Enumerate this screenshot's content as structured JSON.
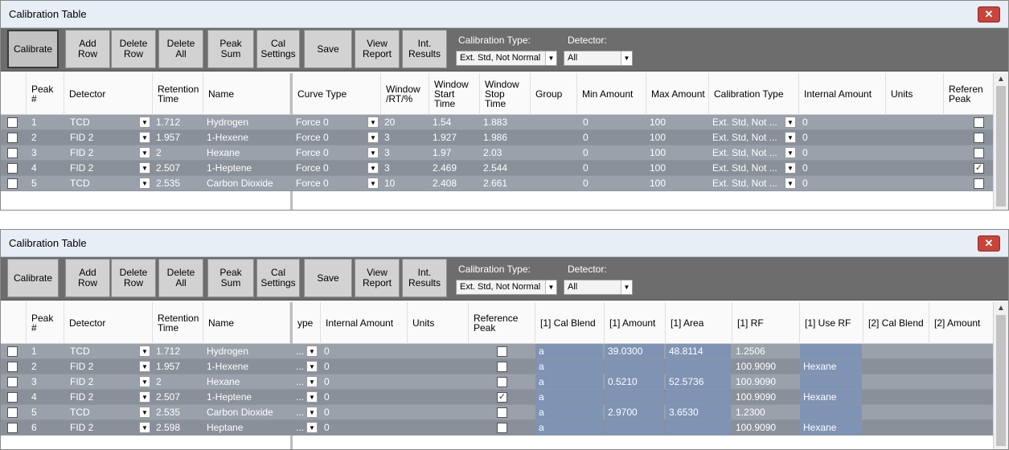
{
  "window": {
    "title": "Calibration Table",
    "close_glyph": "✕"
  },
  "toolbar": {
    "buttons": {
      "calibrate": "Calibrate",
      "add_row": "Add\nRow",
      "delete_row": "Delete\nRow",
      "delete_all": "Delete\nAll",
      "peak_sum": "Peak\nSum",
      "cal_settings": "Cal\nSettings",
      "save": "Save",
      "view_report": "View\nReport",
      "int_results": "Int.\nResults"
    },
    "calibration_type_label": "Calibration Type:",
    "calibration_type_value": "Ext. Std, Not Normal",
    "detector_label": "Detector:",
    "detector_value": "All"
  },
  "colors": {
    "row_light": "#9aa1ab",
    "row_dark": "#8a9099",
    "highlight": "#7f93b4",
    "toolbar": "#6d6d6d"
  },
  "panel1": {
    "headers": {
      "peak": "Peak\n#",
      "detector": "Detector",
      "retention_time": "Retention\nTime",
      "name": "Name",
      "curve_type": "Curve Type",
      "window": "Window\n/RT/%",
      "window_start": "Window\nStart\nTime",
      "window_stop": "Window\nStop\nTime",
      "group": "Group",
      "min_amount": "Min Amount",
      "max_amount": "Max Amount",
      "calibration_type": "Calibration Type",
      "internal_amount": "Internal Amount",
      "units": "Units",
      "reference_peak": "Referen\nPeak"
    },
    "rows": [
      {
        "peak": "1",
        "detector": "TCD",
        "rt": "1.712",
        "name": "Hydrogen",
        "curve": "Force 0",
        "window": "20",
        "start": "1.54",
        "stop": "1.883",
        "group": "",
        "min": "0",
        "max": "100",
        "caltype": "Ext. Std, Not ...",
        "internal": "0",
        "units": "",
        "ref": ""
      },
      {
        "peak": "2",
        "detector": "FID 2",
        "rt": "1.957",
        "name": "1-Hexene",
        "curve": "Force 0",
        "window": "3",
        "start": "1.927",
        "stop": "1.986",
        "group": "",
        "min": "0",
        "max": "100",
        "caltype": "Ext. Std, Not ...",
        "internal": "0",
        "units": "",
        "ref": ""
      },
      {
        "peak": "3",
        "detector": "FID 2",
        "rt": "2",
        "name": "Hexane",
        "curve": "Force 0",
        "window": "3",
        "start": "1.97",
        "stop": "2.03",
        "group": "",
        "min": "0",
        "max": "100",
        "caltype": "Ext. Std, Not ...",
        "internal": "0",
        "units": "",
        "ref": ""
      },
      {
        "peak": "4",
        "detector": "FID 2",
        "rt": "2.507",
        "name": "1-Heptene",
        "curve": "Force 0",
        "window": "3",
        "start": "2.469",
        "stop": "2.544",
        "group": "",
        "min": "0",
        "max": "100",
        "caltype": "Ext. Std, Not ...",
        "internal": "0",
        "units": "",
        "ref": "✓"
      },
      {
        "peak": "5",
        "detector": "TCD",
        "rt": "2.535",
        "name": "Carbon Dioxide",
        "curve": "Force 0",
        "window": "10",
        "start": "2.408",
        "stop": "2.661",
        "group": "",
        "min": "0",
        "max": "100",
        "caltype": "Ext. Std, Not ...",
        "internal": "0",
        "units": "",
        "ref": ""
      }
    ]
  },
  "panel2": {
    "headers": {
      "peak": "Peak\n#",
      "detector": "Detector",
      "retention_time": "Retention\nTime",
      "name": "Name",
      "type_partial": "ype",
      "internal_amount": "Internal Amount",
      "units": "Units",
      "reference_peak": "Reference\nPeak",
      "cal_blend_1": "[1] Cal Blend",
      "amount_1": "[1] Amount",
      "area_1": "[1] Area",
      "rf_1": "[1] RF",
      "use_rf_1": "[1] Use RF",
      "cal_blend_2": "[2] Cal Blend",
      "amount_2": "[2] Amount"
    },
    "rows": [
      {
        "peak": "1",
        "detector": "TCD",
        "rt": "1.712",
        "name": "Hydrogen",
        "type": "...",
        "internal": "0",
        "units": "",
        "ref": "",
        "blend1": "a",
        "amount1": "39.0300",
        "area1": "48.8114",
        "rf1": "1.2506",
        "userf1": "",
        "blend2": "",
        "amount2": ""
      },
      {
        "peak": "2",
        "detector": "FID 2",
        "rt": "1.957",
        "name": "1-Hexene",
        "type": "...",
        "internal": "0",
        "units": "",
        "ref": "",
        "blend1": "a",
        "amount1": "",
        "area1": "",
        "rf1": "100.9090",
        "userf1": "Hexane",
        "blend2": "",
        "amount2": ""
      },
      {
        "peak": "3",
        "detector": "FID 2",
        "rt": "2",
        "name": "Hexane",
        "type": "...",
        "internal": "0",
        "units": "",
        "ref": "",
        "blend1": "a",
        "amount1": "0.5210",
        "area1": "52.5736",
        "rf1": "100.9090",
        "userf1": "",
        "blend2": "",
        "amount2": ""
      },
      {
        "peak": "4",
        "detector": "FID 2",
        "rt": "2.507",
        "name": "1-Heptene",
        "type": "...",
        "internal": "0",
        "units": "",
        "ref": "✓",
        "blend1": "a",
        "amount1": "",
        "area1": "",
        "rf1": "100.9090",
        "userf1": "Hexane",
        "blend2": "",
        "amount2": ""
      },
      {
        "peak": "5",
        "detector": "TCD",
        "rt": "2.535",
        "name": "Carbon Dioxide",
        "type": "...",
        "internal": "0",
        "units": "",
        "ref": "",
        "blend1": "a",
        "amount1": "2.9700",
        "area1": "3.6530",
        "rf1": "1.2300",
        "userf1": "",
        "blend2": "",
        "amount2": ""
      },
      {
        "peak": "6",
        "detector": "FID 2",
        "rt": "2.598",
        "name": "Heptane",
        "type": "...",
        "internal": "0",
        "units": "",
        "ref": "",
        "blend1": "a",
        "amount1": "",
        "area1": "",
        "rf1": "100.9090",
        "userf1": "Hexane",
        "blend2": "",
        "amount2": ""
      }
    ]
  }
}
